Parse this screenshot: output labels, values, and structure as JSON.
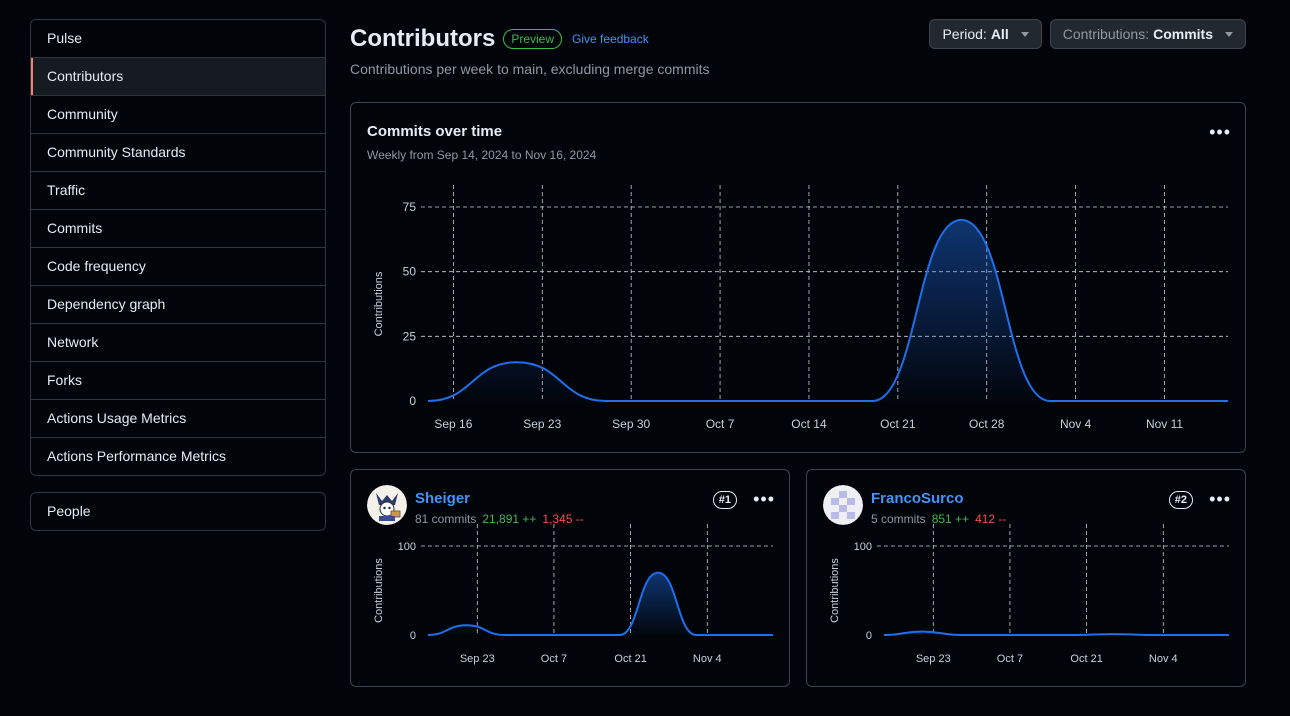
{
  "sidebar": {
    "items": [
      "Pulse",
      "Contributors",
      "Community",
      "Community Standards",
      "Traffic",
      "Commits",
      "Code frequency",
      "Dependency graph",
      "Network",
      "Forks",
      "Actions Usage Metrics",
      "Actions Performance Metrics"
    ],
    "active": "Contributors",
    "people_label": "People"
  },
  "header": {
    "title": "Contributors",
    "badge": "Preview",
    "feedback": "Give feedback",
    "subtitle": "Contributions per week to main, excluding merge commits",
    "period_label": "Period:",
    "period_value": "All",
    "contrib_label": "Contributions:",
    "contrib_value": "Commits"
  },
  "colors": {
    "accent": "#4493f8",
    "line": "#1f6feb",
    "added": "#3fb950",
    "deleted": "#f85149"
  },
  "chart_data": [
    {
      "type": "area",
      "title": "Commits over time",
      "subtitle": "Weekly from Sep 14, 2024 to Nov 16, 2024",
      "ylabel": "Contributions",
      "ylim": [
        0,
        75
      ],
      "yticks": [
        0,
        25,
        50,
        75
      ],
      "xticks": [
        "Sep 16",
        "Sep 23",
        "Sep 30",
        "Oct 7",
        "Oct 14",
        "Oct 21",
        "Oct 28",
        "Nov 4",
        "Nov 11"
      ],
      "x": [
        "Sep 14",
        "Sep 21",
        "Sep 28",
        "Oct 5",
        "Oct 12",
        "Oct 19",
        "Oct 26",
        "Nov 2",
        "Nov 9",
        "Nov 16"
      ],
      "series": [
        {
          "values": [
            0,
            15,
            0,
            0,
            0,
            0,
            70,
            0,
            0,
            0
          ]
        }
      ]
    },
    {
      "type": "area",
      "ylabel": "Contributions",
      "ylim": [
        0,
        100
      ],
      "yticks": [
        0,
        100
      ],
      "xticks": [
        "Sep 23",
        "Oct 7",
        "Oct 21",
        "Nov 4"
      ],
      "x": [
        "Sep 14",
        "Sep 21",
        "Sep 28",
        "Oct 5",
        "Oct 12",
        "Oct 19",
        "Oct 26",
        "Nov 2",
        "Nov 9",
        "Nov 16"
      ],
      "series": [
        {
          "values": [
            0,
            11,
            0,
            0,
            0,
            0,
            70,
            0,
            0,
            0
          ]
        }
      ]
    },
    {
      "type": "area",
      "ylabel": "Contributions",
      "ylim": [
        0,
        100
      ],
      "yticks": [
        0,
        100
      ],
      "xticks": [
        "Sep 23",
        "Oct 7",
        "Oct 21",
        "Nov 4"
      ],
      "x": [
        "Sep 14",
        "Sep 21",
        "Sep 28",
        "Oct 5",
        "Oct 12",
        "Oct 19",
        "Oct 26",
        "Nov 2",
        "Nov 9",
        "Nov 16"
      ],
      "series": [
        {
          "values": [
            0,
            4,
            0,
            0,
            0,
            0,
            1,
            0,
            0,
            0
          ]
        }
      ]
    }
  ],
  "contributors": [
    {
      "name": "Sheiger",
      "commits": "81 commits",
      "additions": "21,891 ++",
      "deletions": "1,345 --",
      "rank": "#1"
    },
    {
      "name": "FrancoSurco",
      "commits": "5 commits",
      "additions": "851 ++",
      "deletions": "412 --",
      "rank": "#2"
    }
  ]
}
